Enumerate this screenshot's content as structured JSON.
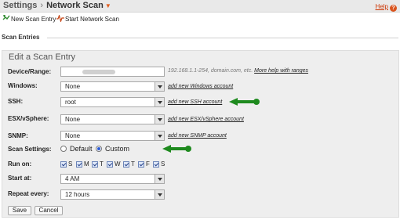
{
  "header": {
    "breadcrumb_root": "Settings",
    "breadcrumb_sep": "›",
    "breadcrumb_current": "Network Scan",
    "help_label": "Help"
  },
  "toolbar": {
    "new_entry": "New Scan Entry",
    "start_scan": "Start Network Scan"
  },
  "section_title": "Scan Entries",
  "form": {
    "title": "Edit a Scan Entry",
    "device_range": {
      "label": "Device/Range:",
      "hint": "192.168.1.1-254, domain.com, etc.",
      "help_link": "More help with ranges"
    },
    "windows": {
      "label": "Windows:",
      "value": "None",
      "link": "add new Windows account"
    },
    "ssh": {
      "label": "SSH:",
      "value": "root",
      "link": "add new SSH account"
    },
    "esx": {
      "label": "ESX/vSphere:",
      "value": "None",
      "link": "add new ESX/vSphere account"
    },
    "snmp": {
      "label": "SNMP:",
      "value": "None",
      "link": "add new SNMP account"
    },
    "scan_settings": {
      "label": "Scan Settings:",
      "options": [
        "Default",
        "Custom"
      ],
      "selected": "Custom"
    },
    "run_on": {
      "label": "Run on:",
      "days": [
        "S",
        "M",
        "T",
        "W",
        "T",
        "F",
        "S"
      ],
      "checked": [
        true,
        true,
        true,
        true,
        true,
        true,
        true
      ]
    },
    "start_at": {
      "label": "Start at:",
      "value": "4 AM"
    },
    "repeat_every": {
      "label": "Repeat every:",
      "value": "12 hours"
    },
    "save_button": "Save",
    "cancel_button": "Cancel"
  },
  "colors": {
    "arrow": "#1e8a1e",
    "help_icon": "#d9541e",
    "panel_bg": "#eeeeee"
  }
}
